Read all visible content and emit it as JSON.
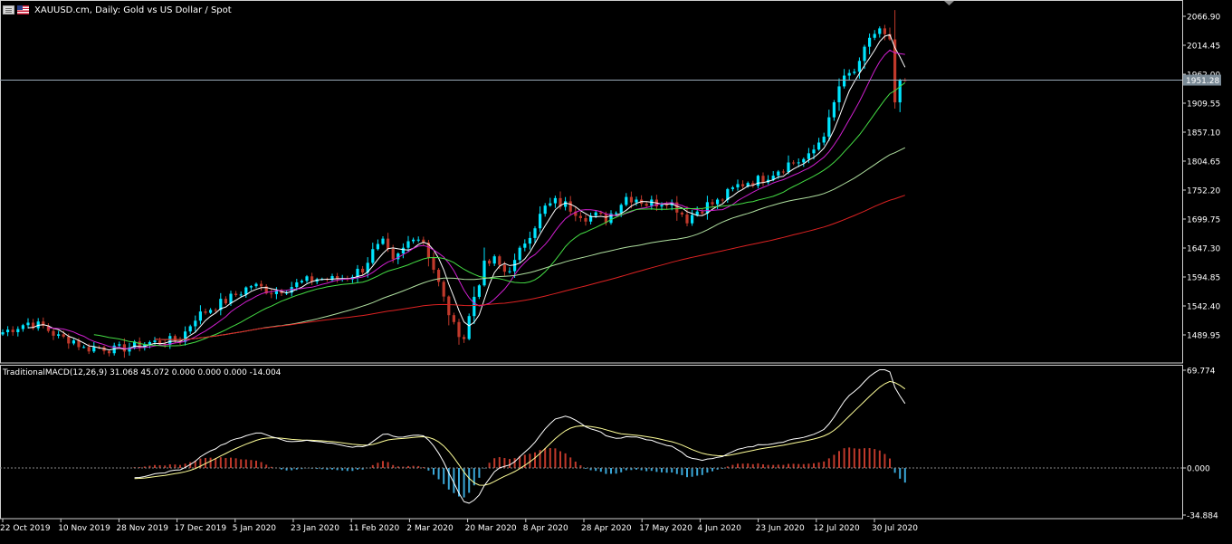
{
  "header": {
    "symbol_title": "XAUUSD.cm, Daily:  Gold vs US Dollar / Spot"
  },
  "indicator": {
    "label": "TraditionalMACD(12,26,9) 31.068 45.072 0.000 0.000 0.000 -14.004"
  },
  "colors": {
    "background": "#000000",
    "bull_candle": "#00e5ff",
    "bear_candle": "#c0392b",
    "ma_fast": "#ffffff",
    "ma_10": "#d01fd0",
    "ma_20": "#44dd44",
    "ma_50": "#b0e0a0",
    "ma_200": "#dd2222",
    "macd_line": "#ffffff",
    "signal_line": "#ffff99",
    "hist_pos": "#c0392b",
    "hist_neg": "#3aa7d8",
    "grid_line": "#8a8a8a",
    "current_price_line": "#9aaab8"
  },
  "chart_data": [
    {
      "type": "candlestick",
      "title": "XAUUSD.cm, Daily:  Gold vs US Dollar / Spot",
      "ylim": [
        1455,
        2085
      ],
      "y_ticks": [
        "2066.90",
        "2014.45",
        "1962.00",
        "1909.55",
        "1857.10",
        "1804.65",
        "1752.20",
        "1699.75",
        "1647.30",
        "1594.85",
        "1542.40",
        "1489.95"
      ],
      "current_price": "1951.28",
      "x_ticks": [
        "22 Oct 2019",
        "10 Nov 2019",
        "28 Nov 2019",
        "17 Dec 2019",
        "5 Jan 2020",
        "23 Jan 2020",
        "11 Feb 2020",
        "2 Mar 2020",
        "20 Mar 2020",
        "8 Apr 2020",
        "28 Apr 2020",
        "17 May 2020",
        "4 Jun 2020",
        "23 Jun 2020",
        "12 Jul 2020",
        "30 Jul 2020"
      ],
      "price_path": [
        [
          0,
          1495
        ],
        [
          5,
          1512
        ],
        [
          8,
          1505
        ],
        [
          11,
          1486
        ],
        [
          14,
          1480
        ],
        [
          16,
          1465
        ],
        [
          19,
          1468
        ],
        [
          22,
          1463
        ],
        [
          26,
          1470
        ],
        [
          29,
          1476
        ],
        [
          32,
          1478
        ],
        [
          35,
          1482
        ],
        [
          38,
          1522
        ],
        [
          41,
          1538
        ],
        [
          44,
          1552
        ],
        [
          47,
          1568
        ],
        [
          49,
          1580
        ],
        [
          51,
          1575
        ],
        [
          53,
          1569
        ],
        [
          56,
          1575
        ],
        [
          59,
          1585
        ],
        [
          62,
          1592
        ],
        [
          65,
          1590
        ],
        [
          68,
          1595
        ],
        [
          71,
          1610
        ],
        [
          73,
          1640
        ],
        [
          75,
          1655
        ],
        [
          77,
          1620
        ],
        [
          79,
          1645
        ],
        [
          81,
          1672
        ],
        [
          83,
          1660
        ],
        [
          85,
          1610
        ],
        [
          87,
          1555
        ],
        [
          89,
          1505
        ],
        [
          91,
          1485
        ],
        [
          93,
          1560
        ],
        [
          95,
          1615
        ],
        [
          97,
          1625
        ],
        [
          99,
          1605
        ],
        [
          101,
          1620
        ],
        [
          103,
          1660
        ],
        [
          105,
          1690
        ],
        [
          107,
          1720
        ],
        [
          109,
          1730
        ],
        [
          111,
          1725
        ],
        [
          113,
          1715
        ],
        [
          115,
          1705
        ],
        [
          117,
          1705
        ],
        [
          119,
          1700
        ],
        [
          121,
          1720
        ],
        [
          123,
          1740
        ],
        [
          125,
          1738
        ],
        [
          127,
          1728
        ],
        [
          129,
          1730
        ],
        [
          131,
          1735
        ],
        [
          133,
          1720
        ],
        [
          135,
          1700
        ],
        [
          137,
          1715
        ],
        [
          139,
          1725
        ],
        [
          141,
          1730
        ],
        [
          143,
          1745
        ],
        [
          145,
          1760
        ],
        [
          147,
          1768
        ],
        [
          149,
          1770
        ],
        [
          151,
          1780
        ],
        [
          153,
          1790
        ],
        [
          155,
          1800
        ],
        [
          157,
          1805
        ],
        [
          159,
          1810
        ],
        [
          161,
          1840
        ],
        [
          163,
          1875
        ],
        [
          165,
          1940
        ],
        [
          167,
          1960
        ],
        [
          169,
          1975
        ],
        [
          171,
          2030
        ],
        [
          173,
          2040
        ],
        [
          175,
          2015
        ],
        [
          176,
          1910
        ],
        [
          177,
          1940
        ],
        [
          178,
          1950
        ]
      ],
      "last_bar": 178,
      "moving_averages": [
        {
          "period": 5,
          "color": "#ffffff"
        },
        {
          "period": 10,
          "color": "#d01fd0"
        },
        {
          "period": 20,
          "color": "#44dd44"
        },
        {
          "period": 50,
          "color": "#b0e0a0"
        },
        {
          "period": 100,
          "color": "#dd2222"
        }
      ]
    },
    {
      "type": "macd",
      "title": "TraditionalMACD(12,26,9) 31.068 45.072 0.000 0.000 0.000 -14.004",
      "params": [
        12,
        26,
        9
      ],
      "values": {
        "macd": 31.068,
        "signal": 45.072,
        "histogram": -14.004
      },
      "ylim": [
        -36,
        70
      ],
      "y_ticks": [
        "69.774",
        "0.000",
        "-34.884"
      ]
    }
  ]
}
